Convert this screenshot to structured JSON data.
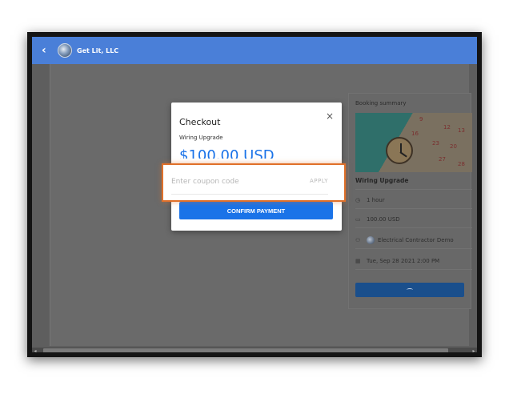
{
  "header": {
    "brand": "Get Lit, LLC"
  },
  "checkout": {
    "title": "Checkout",
    "close": "×",
    "service": "Wiring Upgrade",
    "price": "$100.00 USD",
    "coupon_placeholder": "Enter coupon code",
    "apply_label": "APPLY",
    "confirm_label": "CONFIRM PAYMENT"
  },
  "summary": {
    "title": "Booking summary",
    "service": "Wiring Upgrade",
    "duration": "1 hour",
    "price": "100.00 USD",
    "provider": "Electrical Contractor Demo",
    "datetime": "Tue, Sep 28 2021 2:00 PM",
    "calendar_numbers": [
      "9",
      "16",
      "23",
      "20",
      "27",
      "28",
      "12",
      "13"
    ]
  },
  "colors": {
    "header": "#4a7fd8",
    "accent": "#1a73e8",
    "highlight": "#e0702a"
  }
}
